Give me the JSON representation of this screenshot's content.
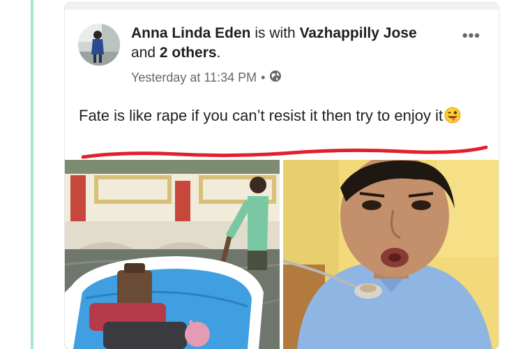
{
  "post": {
    "author": "Anna Linda Eden",
    "with_text": "is with",
    "tagged_person": "Vazhappilly Jose",
    "and_text": "and",
    "others": "2 others",
    "period": ".",
    "timestamp": "Yesterday at 11:34 PM",
    "separator": "•",
    "audience_icon": "globe-icon",
    "text": "Fate is like rape if you can’t resist it then try to enjoy it",
    "emoji": "winking-face-with-tongue",
    "more_label": "•••"
  },
  "colors": {
    "page_stripe": "#a8e6c6",
    "underline": "#e0202a",
    "meta_text": "#65676b"
  }
}
